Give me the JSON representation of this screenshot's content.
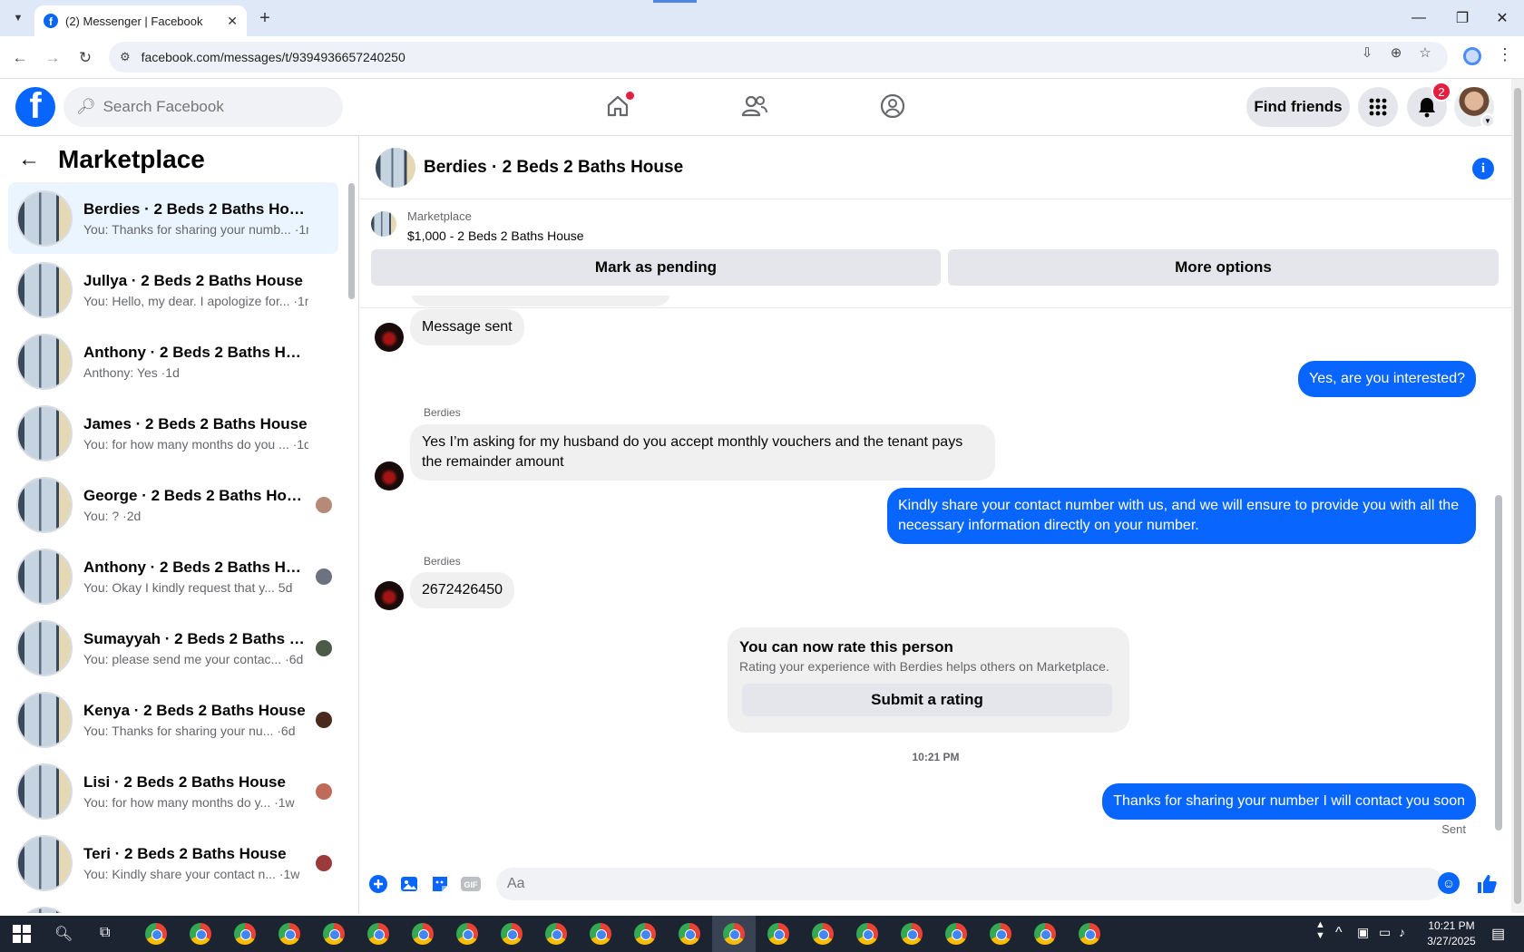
{
  "browser": {
    "tab_title": "(2) Messenger | Facebook",
    "url": "facebook.com/messages/t/9394936657240250",
    "new_tab_icon": "+",
    "close_icon": "✕"
  },
  "fb_header": {
    "search_placeholder": "Search Facebook",
    "find_friends": "Find friends",
    "notification_count": "2"
  },
  "sidebar": {
    "title": "Marketplace",
    "conversations": [
      {
        "name": "Berdies · 2 Beds 2 Baths House",
        "preview": "You: Thanks for sharing your numb... ·1m",
        "active": true,
        "mini_color": ""
      },
      {
        "name": "Jullya · 2 Beds 2 Baths House",
        "preview": "You: Hello, my dear. I apologize for... ·1m",
        "active": false,
        "mini_color": ""
      },
      {
        "name": "Anthony · 2 Beds 2 Baths House",
        "preview": "Anthony: Yes ·1d",
        "active": false,
        "mini_color": ""
      },
      {
        "name": "James · 2 Beds 2 Baths House",
        "preview": "You: for how many months do you ... ·1d",
        "active": false,
        "mini_color": ""
      },
      {
        "name": "George · 2 Beds 2 Baths House",
        "preview": "You: ? ·2d",
        "active": false,
        "mini_color": "#b58a78"
      },
      {
        "name": "Anthony · 2 Beds 2 Baths House",
        "preview": "You: Okay I kindly request that y... 5d",
        "active": false,
        "mini_color": "#6c7280"
      },
      {
        "name": "Sumayyah · 2 Beds 2 Baths Ho...",
        "preview": "You: please send me your contac... ·6d",
        "active": false,
        "mini_color": "#4c5a48"
      },
      {
        "name": "Kenya · 2 Beds 2 Baths House",
        "preview": "You: Thanks for sharing your nu... ·6d",
        "active": false,
        "mini_color": "#4a2a1c"
      },
      {
        "name": "Lisi · 2 Beds 2 Baths House",
        "preview": "You: for how many months do y... ·1w",
        "active": false,
        "mini_color": "#c06a5a"
      },
      {
        "name": "Teri · 2 Beds 2 Baths House",
        "preview": "You: Kindly share your contact n... ·1w",
        "active": false,
        "mini_color": "#9a3a3a"
      }
    ]
  },
  "chat": {
    "title": "Berdies · 2 Beds 2 Baths House",
    "listing_label": "Marketplace",
    "listing_price": "$1,000 - 2 Beds 2 Baths House",
    "mark_pending": "Mark as pending",
    "more_options": "More options",
    "messages": {
      "m1": "Message sent",
      "m2": "Yes, are you interested?",
      "sender1": "Berdies",
      "m3": "Yes I’m asking for my husband do you accept  monthly vouchers and the tenant pays the remainder amount",
      "m4": "Kindly share your contact number with us, and we will ensure to provide you with all the necessary information directly on your number.",
      "sender2": "Berdies",
      "m5": "2672426450",
      "m6": "Thanks for sharing your number I will contact you soon"
    },
    "rate": {
      "heading": "You can now rate this person",
      "sub": "Rating your experience with Berdies helps others on Marketplace.",
      "button": "Submit a rating"
    },
    "timestamp": "10:21 PM",
    "status": "Sent",
    "composer_placeholder": "Aa"
  },
  "taskbar": {
    "time": "10:21 PM",
    "date": "3/27/2025"
  },
  "colors": {
    "accent": "#0866ff",
    "bubble_in": "#f0f0f0",
    "notification": "#e41e3f"
  }
}
